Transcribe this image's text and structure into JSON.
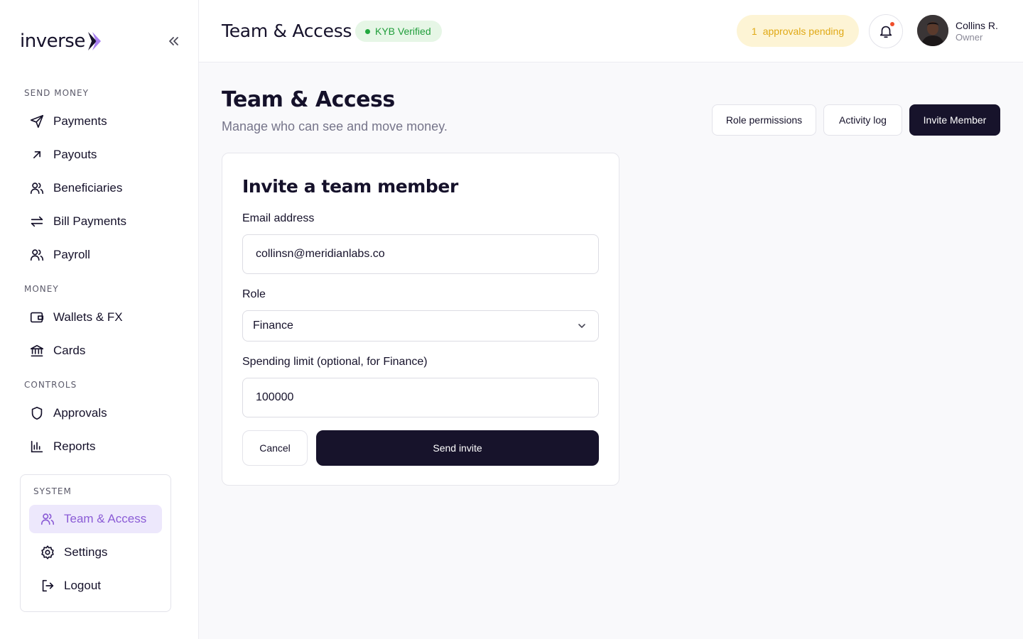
{
  "brand": {
    "name": "inverse"
  },
  "sidebar": {
    "sections": [
      {
        "label": "SEND MONEY",
        "items": [
          {
            "label": "Payments"
          },
          {
            "label": "Payouts"
          },
          {
            "label": "Beneficiaries"
          },
          {
            "label": "Bill Payments"
          },
          {
            "label": "Payroll"
          }
        ]
      },
      {
        "label": "MONEY",
        "items": [
          {
            "label": "Wallets & FX"
          },
          {
            "label": "Cards"
          }
        ]
      },
      {
        "label": "CONTROLS",
        "items": [
          {
            "label": "Approvals"
          },
          {
            "label": "Reports"
          }
        ]
      },
      {
        "label": "SYSTEM",
        "items": [
          {
            "label": "Team & Access",
            "active": true
          },
          {
            "label": "Settings"
          },
          {
            "label": "Logout"
          }
        ]
      }
    ]
  },
  "header": {
    "title": "Team & Access",
    "kyb_badge": "KYB Verified",
    "approvals_count": "1",
    "approvals_text": "approvals pending",
    "user": {
      "name": "Collins R.",
      "role": "Owner"
    }
  },
  "page": {
    "title": "Team & Access",
    "subtitle": "Manage who can see and move money.",
    "actions": {
      "role_permissions": "Role permissions",
      "activity_log": "Activity log",
      "invite_member": "Invite Member"
    }
  },
  "invite_form": {
    "title": "Invite a team member",
    "email_label": "Email address",
    "email_value": "collinsn@meridianlabs.co",
    "role_label": "Role",
    "role_value": "Finance",
    "limit_label": "Spending limit (optional, for Finance)",
    "limit_value": "100000",
    "cancel": "Cancel",
    "submit": "Send invite"
  },
  "colors": {
    "accent": "#8b5cd6",
    "dark": "#17132b",
    "success": "#1f9d3a",
    "warning": "#e0a916"
  }
}
